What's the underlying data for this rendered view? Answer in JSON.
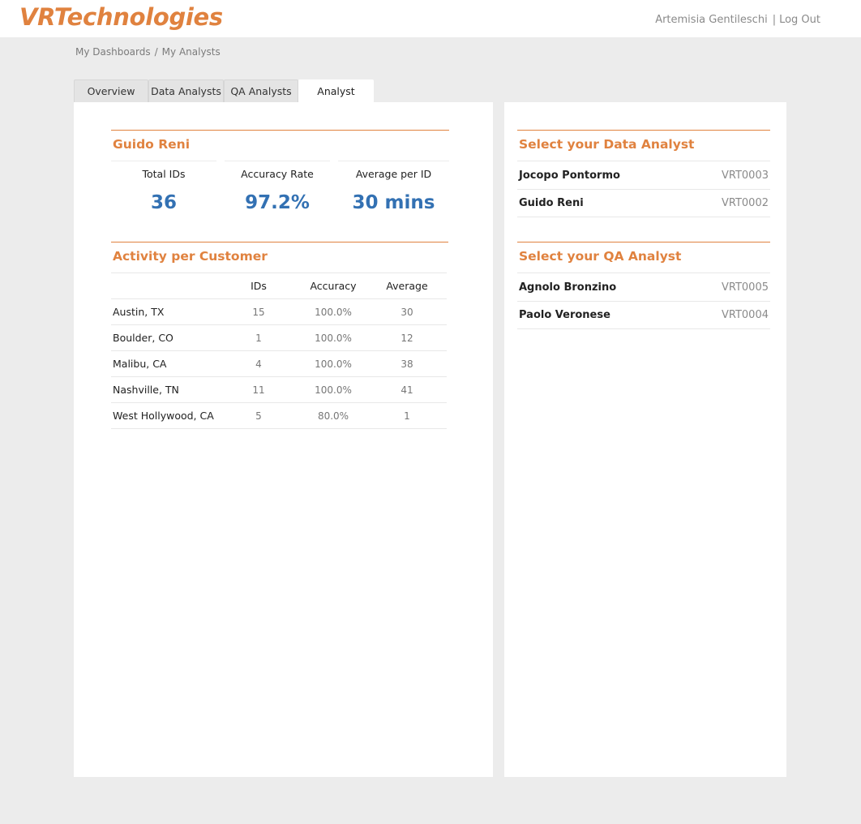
{
  "header": {
    "logo": "VRTechnologies",
    "user_name": "Artemisia Gentileschi",
    "separator": "|",
    "logout_label": "Log Out"
  },
  "breadcrumb": {
    "items": [
      "My Dashboards",
      "My Analysts"
    ],
    "separator": "/"
  },
  "tabs": [
    {
      "label": "Overview",
      "active": false
    },
    {
      "label": "Data Analysts",
      "active": false
    },
    {
      "label": "QA Analysts",
      "active": false
    },
    {
      "label": "Analyst",
      "active": true
    }
  ],
  "analyst_summary": {
    "name": "Guido Reni",
    "stats": [
      {
        "label": "Total IDs",
        "value": "36"
      },
      {
        "label": "Accuracy Rate",
        "value": "97.2%"
      },
      {
        "label": "Average per ID",
        "value": "30 mins"
      }
    ]
  },
  "activity": {
    "title": "Activity per Customer",
    "columns": [
      "",
      "IDs",
      "Accuracy",
      "Average"
    ],
    "rows": [
      {
        "customer": "Austin, TX",
        "ids": "15",
        "accuracy": "100.0%",
        "average": "30"
      },
      {
        "customer": "Boulder, CO",
        "ids": "1",
        "accuracy": "100.0%",
        "average": "12"
      },
      {
        "customer": "Malibu, CA",
        "ids": "4",
        "accuracy": "100.0%",
        "average": "38"
      },
      {
        "customer": "Nashville, TN",
        "ids": "11",
        "accuracy": "100.0%",
        "average": "41"
      },
      {
        "customer": "West Hollywood, CA",
        "ids": "5",
        "accuracy": "80.0%",
        "average": "1"
      }
    ]
  },
  "data_analysts": {
    "title": "Select your Data Analyst",
    "items": [
      {
        "name": "Jocopo Pontormo",
        "code": "VRT0003"
      },
      {
        "name": "Guido Reni",
        "code": "VRT0002"
      }
    ]
  },
  "qa_analysts": {
    "title": "Select your QA Analyst",
    "items": [
      {
        "name": "Agnolo Bronzino",
        "code": "VRT0005"
      },
      {
        "name": "Paolo Veronese",
        "code": "VRT0004"
      }
    ]
  },
  "colors": {
    "accent": "#e0823f",
    "stat_value": "#3371b3",
    "background": "#ececec"
  }
}
